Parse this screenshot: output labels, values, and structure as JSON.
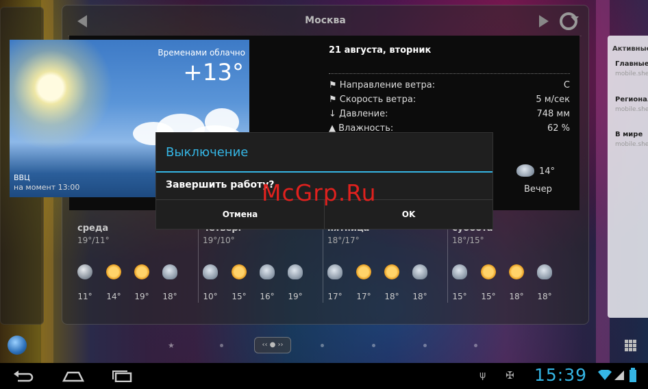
{
  "header": {
    "city": "Москва"
  },
  "current": {
    "condition": "Временами облачно",
    "temperature": "+13°",
    "place": "ВВЦ",
    "moment": "на момент 13:00",
    "date": "21 августа, вторник",
    "details": [
      {
        "label": "Направление ветра:",
        "value": "С"
      },
      {
        "label": "Скорость ветра:",
        "value": "5 м/сек"
      },
      {
        "label": "Давление:",
        "value": "748 мм"
      },
      {
        "label": "Влажность:",
        "value": "62 %"
      }
    ],
    "evening": {
      "temp": "14°",
      "label": "Вечер"
    }
  },
  "forecast": [
    {
      "day": "среда",
      "range": "19°/11°",
      "temps": [
        "11°",
        "14°",
        "19°",
        "18°"
      ],
      "icons": [
        "moon",
        "sun",
        "sun",
        "night-cloud"
      ]
    },
    {
      "day": "четверг",
      "range": "19°/10°",
      "temps": [
        "10°",
        "15°",
        "16°",
        "19°"
      ],
      "icons": [
        "night-cloud",
        "sun-cloud",
        "rain-cloud",
        "night-cloud"
      ]
    },
    {
      "day": "пятница",
      "range": "18°/17°",
      "temps": [
        "17°",
        "17°",
        "18°",
        "18°"
      ],
      "icons": [
        "night-cloud",
        "sun-cloud",
        "sun-cloud",
        "night-cloud"
      ]
    },
    {
      "day": "суббота",
      "range": "18°/15°",
      "temps": [
        "15°",
        "15°",
        "18°",
        "18°"
      ],
      "icons": [
        "night-cloud",
        "sun-cloud",
        "sun-cloud",
        "night-cloud"
      ]
    }
  ],
  "news_widget": {
    "title": "Активные н",
    "items": [
      {
        "title": "Главные н",
        "sub": "mobile.she"
      },
      {
        "title": "Региональ",
        "sub": "mobile.she"
      },
      {
        "title": "В мире",
        "sub": "mobile.she"
      }
    ]
  },
  "dialog": {
    "title": "Выключение",
    "message": "Завершить работу?",
    "cancel": "Отмена",
    "ok": "OK"
  },
  "watermark": "McGrp.Ru",
  "status": {
    "time": "15:39"
  },
  "colors": {
    "accent": "#35b6e5",
    "watermark": "#e0211e"
  }
}
